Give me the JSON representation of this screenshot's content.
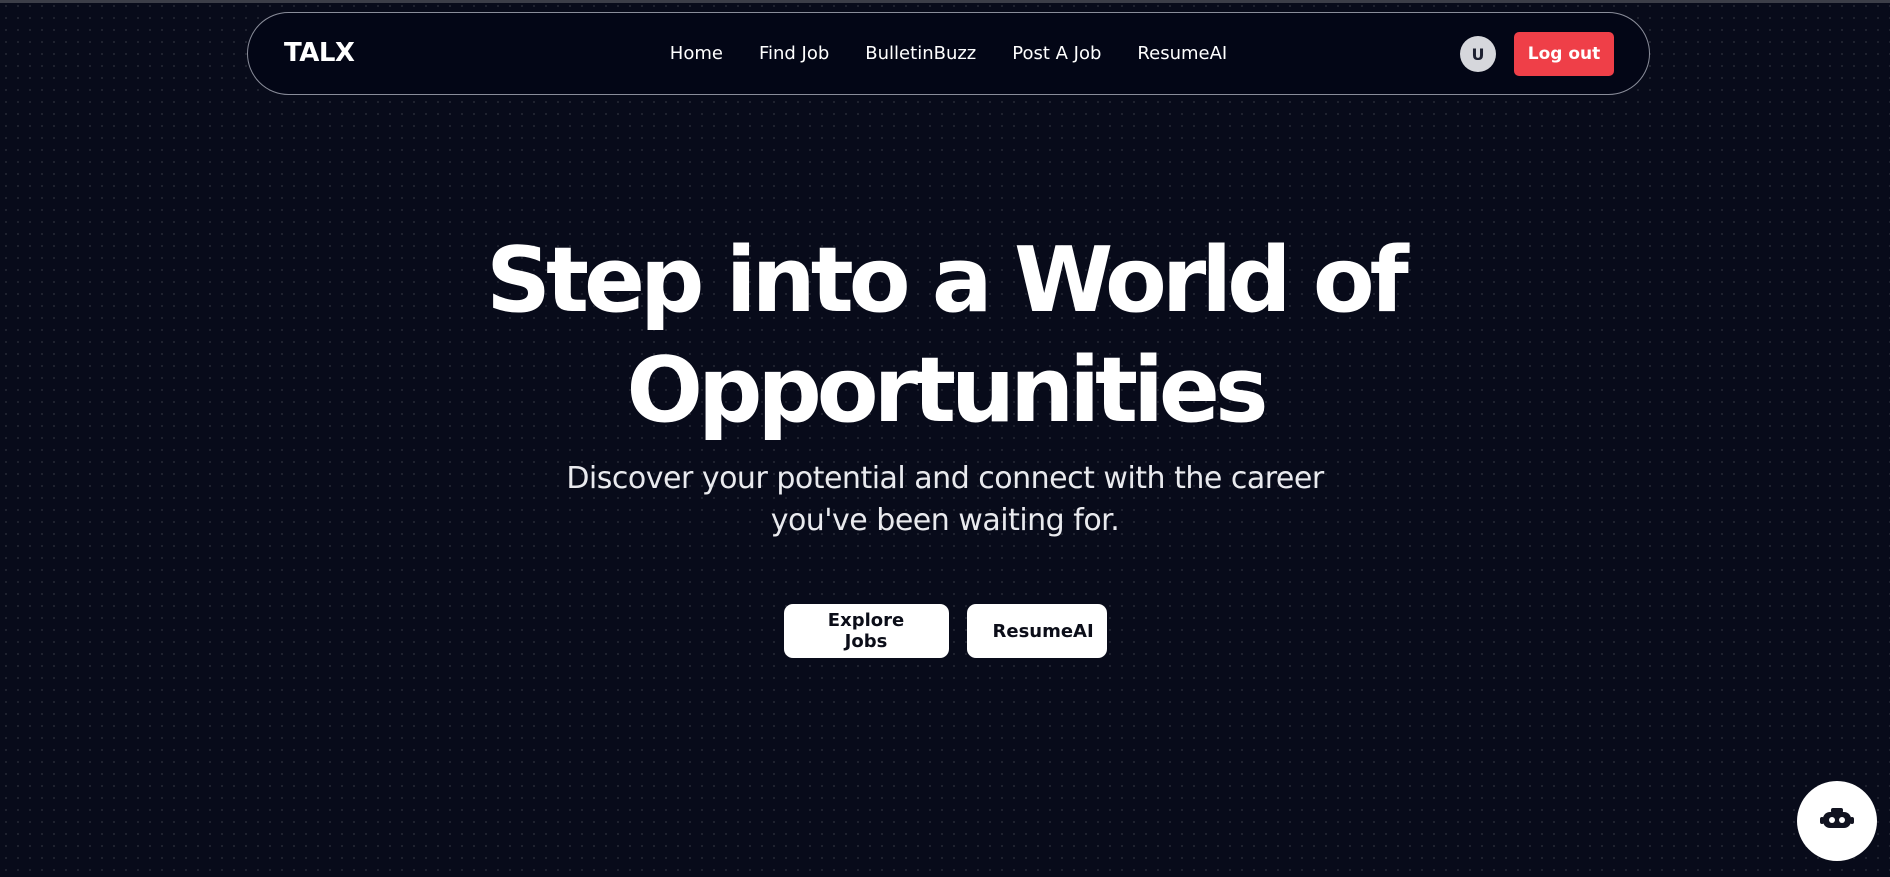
{
  "header": {
    "brand": "TALX",
    "nav": [
      {
        "label": "Home"
      },
      {
        "label": "Find Job"
      },
      {
        "label": "BulletinBuzz"
      },
      {
        "label": "Post A Job"
      },
      {
        "label": "ResumeAI"
      }
    ],
    "avatar_initial": "U",
    "logout_label": "Log out"
  },
  "hero": {
    "title_line1": "Step into a World of",
    "title_line2": "Opportunities",
    "subtitle_line1": "Discover your potential and connect with the career",
    "subtitle_line2": "you've been waiting for.",
    "buttons": {
      "explore": "Explore Jobs",
      "resume": "ResumeAI"
    }
  },
  "chat_widget": {
    "icon": "robot-icon"
  },
  "colors": {
    "background": "#080b1a",
    "navbar_bg": "#030616",
    "logout_red": "#ef3f48",
    "button_white": "#ffffff"
  }
}
